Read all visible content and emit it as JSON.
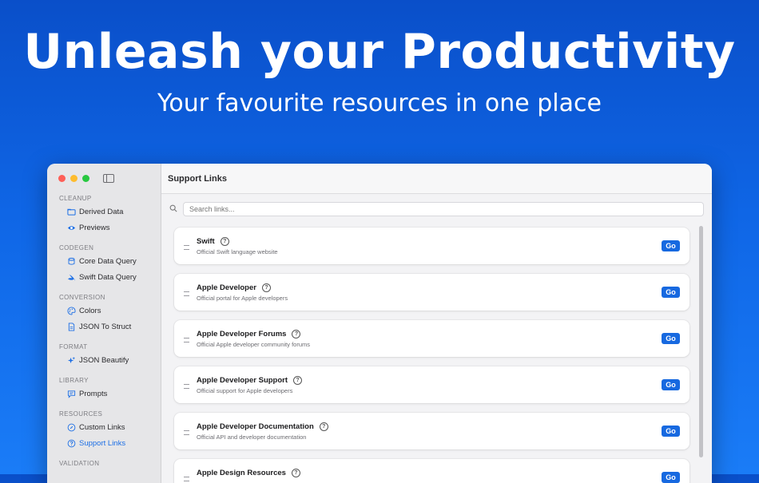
{
  "hero": {
    "headline": "Unleash your Productivity",
    "subhead": "Your favourite resources in one place"
  },
  "sidebar": {
    "sections": [
      {
        "title": "CLEANUP",
        "items": [
          {
            "label": "Derived Data",
            "icon": "folder-icon"
          },
          {
            "label": "Previews",
            "icon": "eye-icon"
          }
        ]
      },
      {
        "title": "CODEGEN",
        "items": [
          {
            "label": "Core Data Query",
            "icon": "database-icon"
          },
          {
            "label": "Swift Data Query",
            "icon": "swift-icon"
          }
        ]
      },
      {
        "title": "CONVERSION",
        "items": [
          {
            "label": "Colors",
            "icon": "palette-icon"
          },
          {
            "label": "JSON To Struct",
            "icon": "document-icon"
          }
        ]
      },
      {
        "title": "FORMAT",
        "items": [
          {
            "label": "JSON Beautify",
            "icon": "sparkles-icon"
          }
        ]
      },
      {
        "title": "LIBRARY",
        "items": [
          {
            "label": "Prompts",
            "icon": "chat-bubble-icon"
          }
        ]
      },
      {
        "title": "RESOURCES",
        "items": [
          {
            "label": "Custom Links",
            "icon": "link-icon"
          },
          {
            "label": "Support Links",
            "icon": "question-circle-icon",
            "active": true
          }
        ]
      },
      {
        "title": "VALIDATION",
        "items": []
      }
    ]
  },
  "main": {
    "title": "Support Links",
    "search_placeholder": "Search links...",
    "go_label": "Go",
    "links": [
      {
        "title": "Swift",
        "description": "Official Swift language website"
      },
      {
        "title": "Apple Developer",
        "description": "Official portal for Apple developers"
      },
      {
        "title": "Apple Developer Forums",
        "description": "Official Apple developer community forums"
      },
      {
        "title": "Apple Developer Support",
        "description": "Official support for Apple developers"
      },
      {
        "title": "Apple Developer Documentation",
        "description": "Official API and developer documentation"
      },
      {
        "title": "Apple Design Resources",
        "description": ""
      }
    ]
  },
  "colors": {
    "accent": "#1769e0",
    "background": "#0f66e6"
  }
}
